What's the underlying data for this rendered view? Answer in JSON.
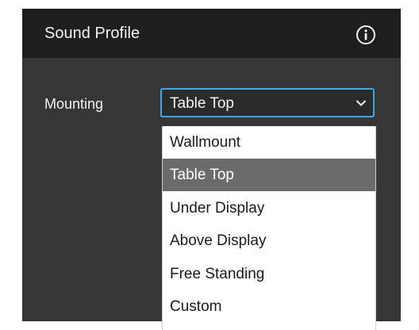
{
  "panel": {
    "title": "Sound Profile",
    "info_icon": "info-circle-icon"
  },
  "mounting": {
    "label": "Mounting",
    "selected_value": "Table Top",
    "chevron_icon": "chevron-down-icon",
    "options": [
      {
        "label": "Wallmount",
        "selected": false
      },
      {
        "label": "Table Top",
        "selected": true
      },
      {
        "label": "Under Display",
        "selected": false
      },
      {
        "label": "Above Display",
        "selected": false
      },
      {
        "label": "Free Standing",
        "selected": false
      },
      {
        "label": "Custom",
        "selected": false
      }
    ]
  },
  "colors": {
    "panel_bg": "#363636",
    "header_bg": "#1e1e1e",
    "select_border": "#3ba8e8",
    "selected_option_bg": "#6b6b6b"
  }
}
